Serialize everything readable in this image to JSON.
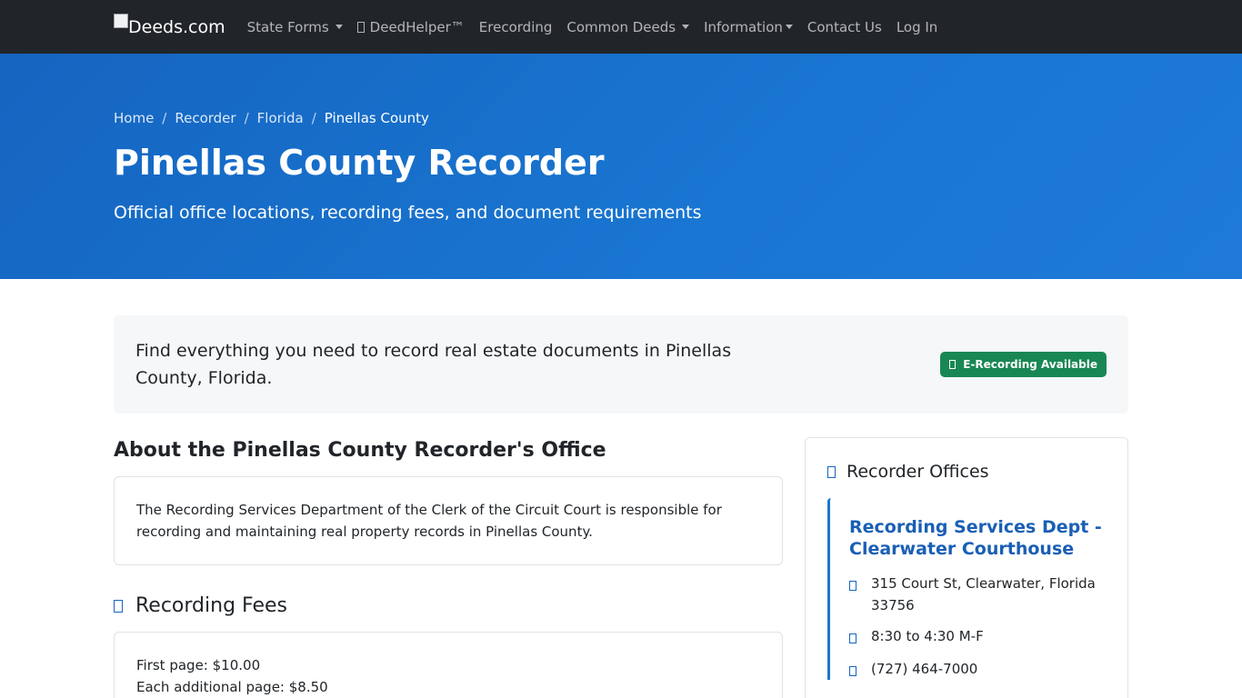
{
  "nav": {
    "brand": "Deeds.com",
    "items": [
      {
        "label": "State Forms",
        "dropdown": true,
        "icon": null
      },
      {
        "label": "DeedHelper™",
        "dropdown": false,
        "icon": "missing-glyph"
      },
      {
        "label": "Erecording",
        "dropdown": false,
        "icon": null
      },
      {
        "label": "Common Deeds",
        "dropdown": true,
        "icon": null
      },
      {
        "label": "Information",
        "dropdown": true,
        "icon": null
      },
      {
        "label": "Contact Us",
        "dropdown": false,
        "icon": null
      },
      {
        "label": "Log In",
        "dropdown": false,
        "icon": null
      }
    ]
  },
  "breadcrumb": [
    "Home",
    "Recorder",
    "Florida",
    "Pinellas County"
  ],
  "hero": {
    "title": "Pinellas County Recorder",
    "subtitle": "Official office locations, recording fees, and document requirements"
  },
  "intro": {
    "text": "Find everything you need to record real estate documents in Pinellas County, Florida.",
    "badge": "E-Recording Available"
  },
  "about": {
    "heading": "About the Pinellas County Recorder's Office",
    "body": "The Recording Services Department of the Clerk of the Circuit Court is responsible for recording and maintaining real property records in Pinellas County."
  },
  "fees": {
    "heading": "Recording Fees",
    "lines": [
      "First page: $10.00",
      "Each additional page: $8.50"
    ]
  },
  "offices": {
    "heading": "Recorder Offices",
    "items": [
      {
        "name": "Recording Services Dept - Clearwater Courthouse",
        "address": "315 Court St, Clearwater, Florida 33756",
        "hours": "8:30 to 4:30 M-F",
        "phone": "(727) 464-7000"
      }
    ]
  },
  "colors": {
    "navbar": "#212529",
    "hero": "#1976d2",
    "badge": "#198754",
    "link": "#1a5fb4"
  }
}
